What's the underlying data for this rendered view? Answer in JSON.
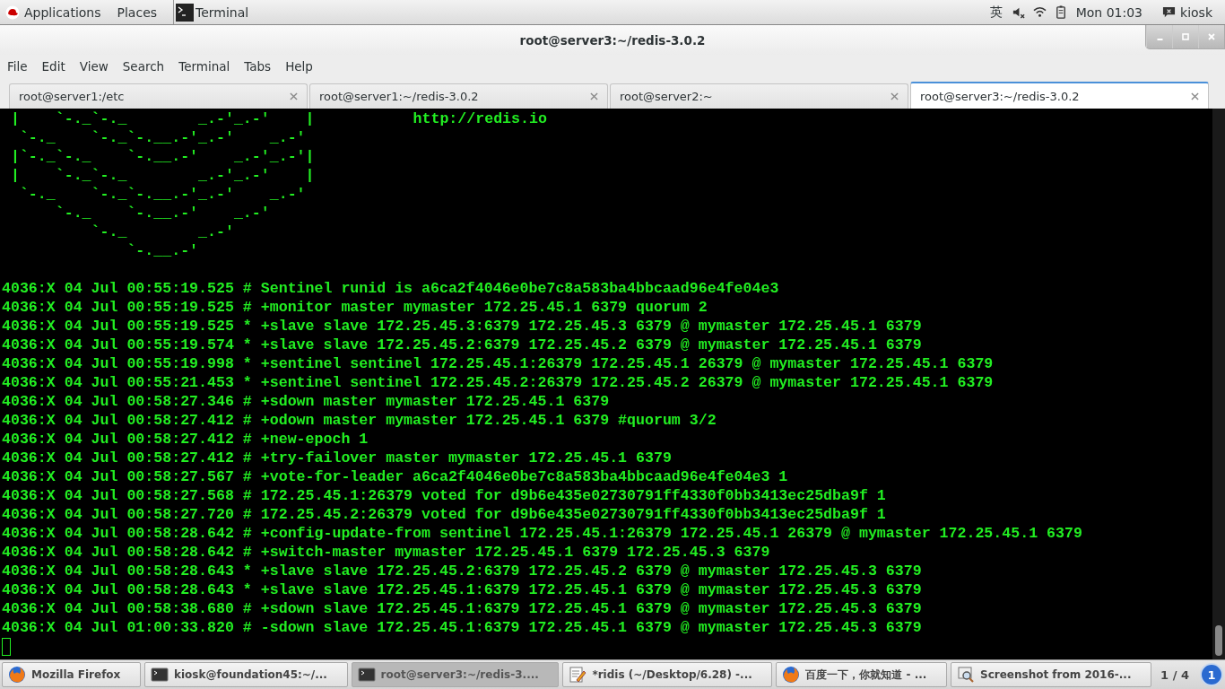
{
  "top_bar": {
    "menus": [
      "Applications",
      "Places"
    ],
    "app_name": "Terminal",
    "input_method": "英",
    "clock": "Mon 01:03",
    "user": "kiosk"
  },
  "window": {
    "title": "root@server3:~/redis-3.0.2"
  },
  "menu_bar": [
    "File",
    "Edit",
    "View",
    "Search",
    "Terminal",
    "Tabs",
    "Help"
  ],
  "tabs": [
    {
      "label": "root@server1:/etc",
      "selected": false
    },
    {
      "label": "root@server1:~/redis-3.0.2",
      "selected": false
    },
    {
      "label": "root@server2:~",
      "selected": false
    },
    {
      "label": "root@server3:~/redis-3.0.2",
      "selected": true
    }
  ],
  "terminal": {
    "banner": [
      " |    `-._`-._        _.-'_.-'    |",
      "  `-._    `-._`-.__.-'_.-'    _.-'",
      " |`-._`-._    `-.__.-'    _.-'_.-'|",
      " |    `-._`-._        _.-'_.-'    |",
      "  `-._    `-._`-.__.-'_.-'    _.-'",
      "      `-._    `-.__.-'    _.-'",
      "          `-._        _.-'",
      "              `-.__.-'"
    ],
    "url": "http://redis.io",
    "log": [
      "4036:X 04 Jul 00:55:19.525 # Sentinel runid is a6ca2f4046e0be7c8a583ba4bbcaad96e4fe04e3",
      "4036:X 04 Jul 00:55:19.525 # +monitor master mymaster 172.25.45.1 6379 quorum 2",
      "4036:X 04 Jul 00:55:19.525 * +slave slave 172.25.45.3:6379 172.25.45.3 6379 @ mymaster 172.25.45.1 6379",
      "4036:X 04 Jul 00:55:19.574 * +slave slave 172.25.45.2:6379 172.25.45.2 6379 @ mymaster 172.25.45.1 6379",
      "4036:X 04 Jul 00:55:19.998 * +sentinel sentinel 172.25.45.1:26379 172.25.45.1 26379 @ mymaster 172.25.45.1 6379",
      "4036:X 04 Jul 00:55:21.453 * +sentinel sentinel 172.25.45.2:26379 172.25.45.2 26379 @ mymaster 172.25.45.1 6379",
      "4036:X 04 Jul 00:58:27.346 # +sdown master mymaster 172.25.45.1 6379",
      "4036:X 04 Jul 00:58:27.412 # +odown master mymaster 172.25.45.1 6379 #quorum 3/2",
      "4036:X 04 Jul 00:58:27.412 # +new-epoch 1",
      "4036:X 04 Jul 00:58:27.412 # +try-failover master mymaster 172.25.45.1 6379",
      "4036:X 04 Jul 00:58:27.567 # +vote-for-leader a6ca2f4046e0be7c8a583ba4bbcaad96e4fe04e3 1",
      "4036:X 04 Jul 00:58:27.568 # 172.25.45.1:26379 voted for d9b6e435e02730791ff4330f0bb3413ec25dba9f 1",
      "4036:X 04 Jul 00:58:27.720 # 172.25.45.2:26379 voted for d9b6e435e02730791ff4330f0bb3413ec25dba9f 1",
      "4036:X 04 Jul 00:58:28.642 # +config-update-from sentinel 172.25.45.1:26379 172.25.45.1 26379 @ mymaster 172.25.45.1 6379",
      "4036:X 04 Jul 00:58:28.642 # +switch-master mymaster 172.25.45.1 6379 172.25.45.3 6379",
      "4036:X 04 Jul 00:58:28.643 * +slave slave 172.25.45.2:6379 172.25.45.2 6379 @ mymaster 172.25.45.3 6379",
      "4036:X 04 Jul 00:58:28.643 * +slave slave 172.25.45.1:6379 172.25.45.1 6379 @ mymaster 172.25.45.3 6379",
      "4036:X 04 Jul 00:58:38.680 # +sdown slave 172.25.45.1:6379 172.25.45.1 6379 @ mymaster 172.25.45.3 6379",
      "4036:X 04 Jul 01:00:33.820 # -sdown slave 172.25.45.1:6379 172.25.45.1 6379 @ mymaster 172.25.45.3 6379"
    ]
  },
  "taskbar": {
    "items": [
      {
        "label": "Mozilla Firefox",
        "kind": "browser",
        "selected": false
      },
      {
        "label": "kiosk@foundation45:~/...",
        "kind": "terminal",
        "selected": false
      },
      {
        "label": "root@server3:~/redis-3....",
        "kind": "terminal",
        "selected": true
      },
      {
        "label": "*ridis (~/Desktop/6.28) -...",
        "kind": "editor",
        "selected": false
      },
      {
        "label": "百度一下，你就知道 - ...",
        "kind": "browser",
        "selected": false
      },
      {
        "label": "Screenshot from 2016-...",
        "kind": "viewer",
        "selected": false
      }
    ],
    "workspace": "1 / 4",
    "notifications": "1"
  }
}
